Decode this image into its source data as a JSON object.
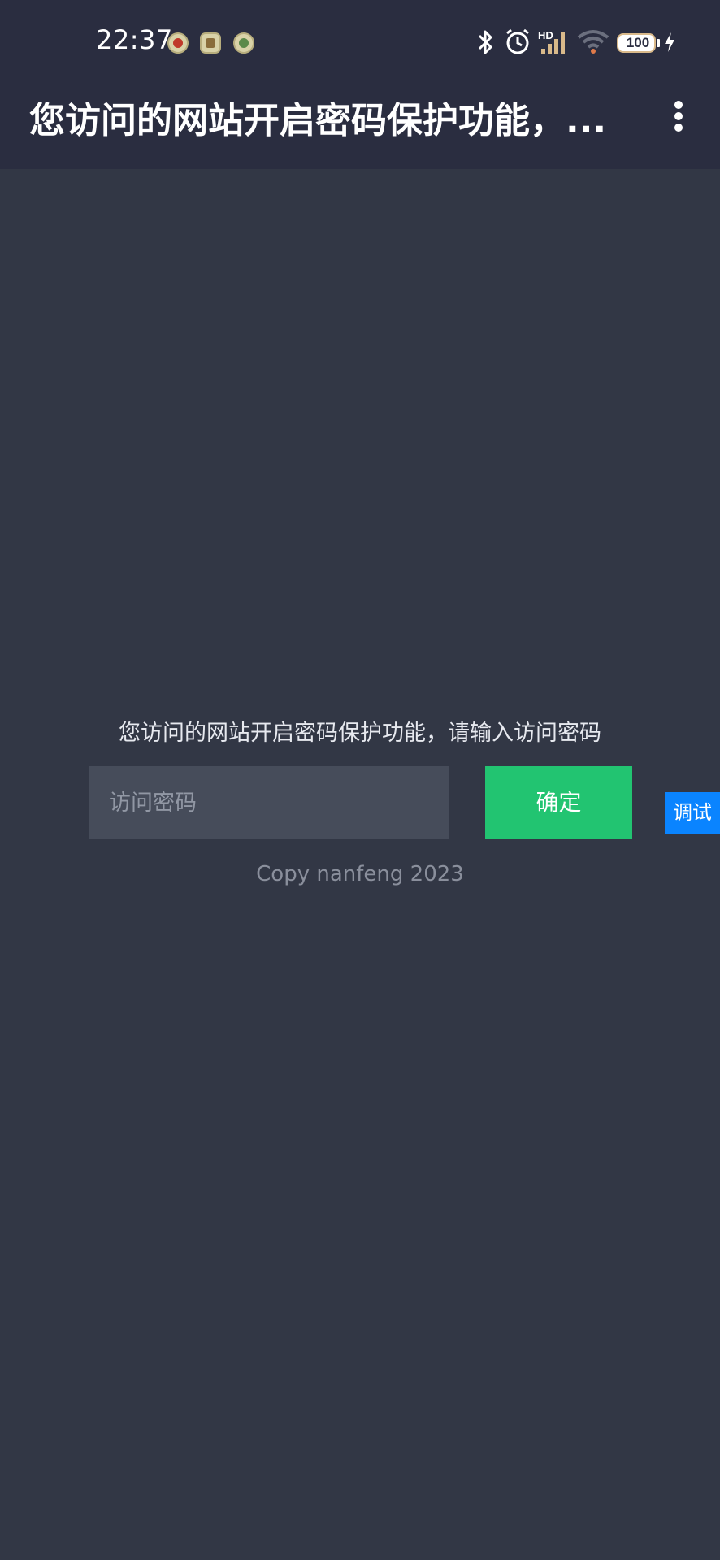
{
  "status_bar": {
    "time": "22:37",
    "notification_icons": [
      "music-app-icon",
      "game-app-icon",
      "wechat-icon"
    ],
    "system_icons": [
      "bluetooth-icon",
      "alarm-icon",
      "hd-signal-icon",
      "wifi-icon",
      "battery-icon",
      "charging-icon"
    ],
    "network_label": "HD",
    "battery_level": "100"
  },
  "app_bar": {
    "title": "您访问的网站开启密码保护功能，...",
    "menu_icon": "more-vert-icon"
  },
  "main": {
    "prompt": "您访问的网站开启密码保护功能，请输入访问密码",
    "password_placeholder": "访问密码",
    "password_value": "",
    "confirm_label": "确定",
    "footer": "Copy nanfeng 2023"
  },
  "debug": {
    "label": "调试"
  },
  "colors": {
    "background": "#323745",
    "topbar": "#2a2d40",
    "accent_green": "#22c471",
    "debug_blue": "#0a84ff"
  }
}
